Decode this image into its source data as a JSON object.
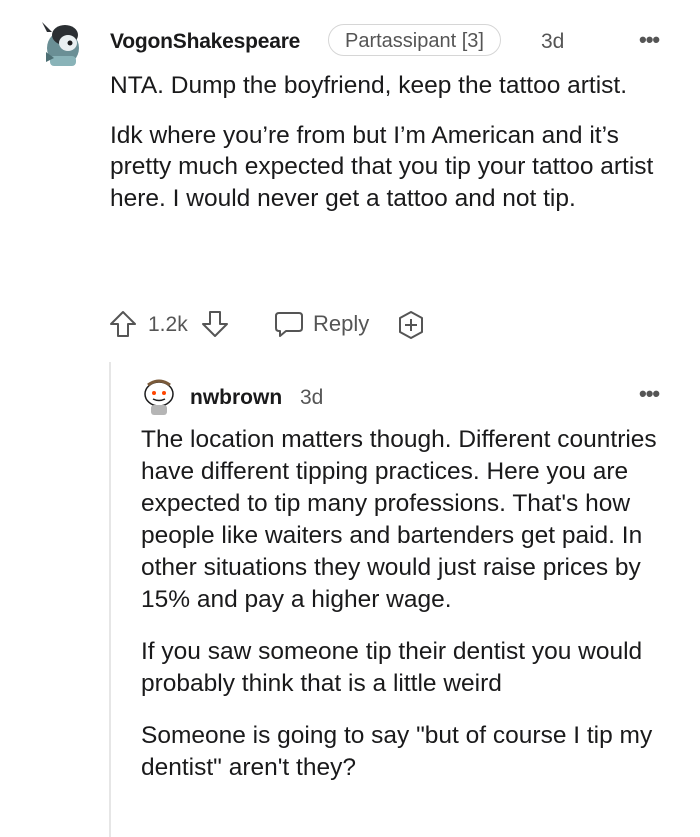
{
  "comment": {
    "username": "VogonShakespeare",
    "flair": "Partassipant [3]",
    "age": "3d",
    "more": "•••",
    "paragraphs": [
      "NTA. Dump the boyfriend, keep the tattoo artist.",
      "Idk where you’re from but I’m American and it’s pretty much expected that you tip your tattoo artist here. I would never get a tattoo and not tip."
    ],
    "votes": "1.2k",
    "reply_label": "Reply"
  },
  "reply": {
    "username": "nwbrown",
    "age": "3d",
    "more": "•••",
    "paragraphs": [
      "The location matters though. Different countries have different tipping practices. Here you are expected to tip many professions. That's how people like waiters and bartenders get paid. In other situations they would just raise prices by 15% and pay a higher wage.",
      "If you saw someone tip their dentist you would probably think that is a little weird",
      "Someone is going to say \"but of course I tip my dentist\" aren't they?"
    ]
  },
  "icons": {
    "upvote": "arrow-up-icon",
    "downvote": "arrow-down-icon",
    "reply": "speech-bubble-icon",
    "award": "plus-badge-icon",
    "more": "ellipsis-icon"
  }
}
